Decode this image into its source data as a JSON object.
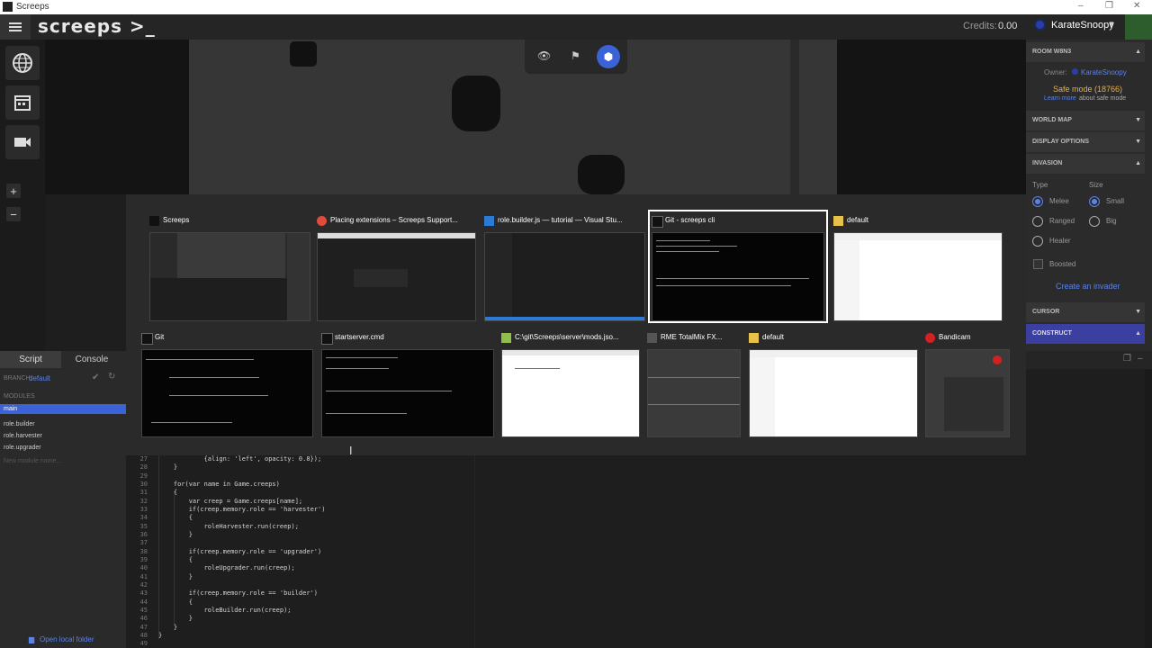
{
  "window": {
    "title": "Screeps",
    "controls": [
      "–",
      "❐",
      "✕"
    ]
  },
  "topbar": {
    "logo": "screeps >_",
    "credits_label": "Credits:",
    "credits_value": "0.00",
    "user": "KarateSnoopy"
  },
  "left_icons": [
    "globe-icon",
    "calendar-icon",
    "video-icon"
  ],
  "zoom": {
    "in": "+",
    "out": "−"
  },
  "room_panel": {
    "title": "ROOM W8N3",
    "owner_label": "Owner:",
    "owner": "KarateSnoopy",
    "safe_mode": "Safe mode (18766)",
    "learn_more_link": "Learn more",
    "learn_more_rest": "about safe mode"
  },
  "sections": {
    "world_map": "WORLD MAP",
    "display_options": "DISPLAY OPTIONS",
    "invasion": "INVASION",
    "cursor": "CURSOR",
    "construct": "CONSTRUCT"
  },
  "invasion": {
    "type_label": "Type",
    "size_label": "Size",
    "types": [
      "Melee",
      "Ranged",
      "Healer"
    ],
    "sizes": [
      "Small",
      "Big"
    ],
    "boosted": "Boosted",
    "create_link": "Create an invader"
  },
  "script_panel": {
    "tabs": [
      "Script",
      "Console"
    ],
    "branch_label": "BRANCH:",
    "branch": "default",
    "modules_label": "MODULES",
    "modules": [
      "main",
      "role.builder",
      "role.harvester",
      "role.upgrader"
    ],
    "new_module_placeholder": "New module name...",
    "open_local_folder": "Open local folder"
  },
  "code": {
    "line_numbers": [
      "27",
      "28",
      "29",
      "30",
      "31",
      "32",
      "33",
      "34",
      "35",
      "36",
      "37",
      "38",
      "39",
      "40",
      "41",
      "42",
      "43",
      "44",
      "45",
      "46",
      "47",
      "48",
      "49"
    ],
    "lines": [
      "            {align: 'left', opacity: 0.8});",
      "    }",
      "",
      "    for(var name in Game.creeps)",
      "    {",
      "        var creep = Game.creeps[name];",
      "        if(creep.memory.role == 'harvester')",
      "        {",
      "            roleHarvester.run(creep);",
      "        }",
      "",
      "        if(creep.memory.role == 'upgrader')",
      "        {",
      "            roleUpgrader.run(creep);",
      "        }",
      "",
      "        if(creep.memory.role == 'builder')",
      "        {",
      "            roleBuilder.run(creep);",
      "        }",
      "    }",
      "}",
      ""
    ]
  },
  "alttab": {
    "row1": [
      {
        "title": "Screeps",
        "icon": "screeps-icon"
      },
      {
        "title": "Placing extensions – Screeps Support...",
        "icon": "chrome-icon"
      },
      {
        "title": "role.builder.js — tutorial — Visual Stu...",
        "icon": "vscode-icon"
      },
      {
        "title": "Git - screeps  cli",
        "icon": "terminal-icon"
      },
      {
        "title": "default",
        "icon": "folder-icon"
      }
    ],
    "row2": [
      {
        "title": "Git",
        "icon": "terminal-icon"
      },
      {
        "title": "startserver.cmd",
        "icon": "terminal-icon"
      },
      {
        "title": "C:\\git\\Screeps\\server\\mods.jso...",
        "icon": "notepad-icon"
      },
      {
        "title": "RME TotalMix FX...",
        "icon": "totalmix-icon"
      },
      {
        "title": "default",
        "icon": "folder-icon"
      },
      {
        "title": "Bandicam",
        "icon": "bandicam-icon"
      }
    ]
  },
  "colors": {
    "accent": "#3b62d6",
    "link": "#5b82e8",
    "safe_mode": "#e8b04a",
    "construct_bg": "#3a3fa0"
  }
}
